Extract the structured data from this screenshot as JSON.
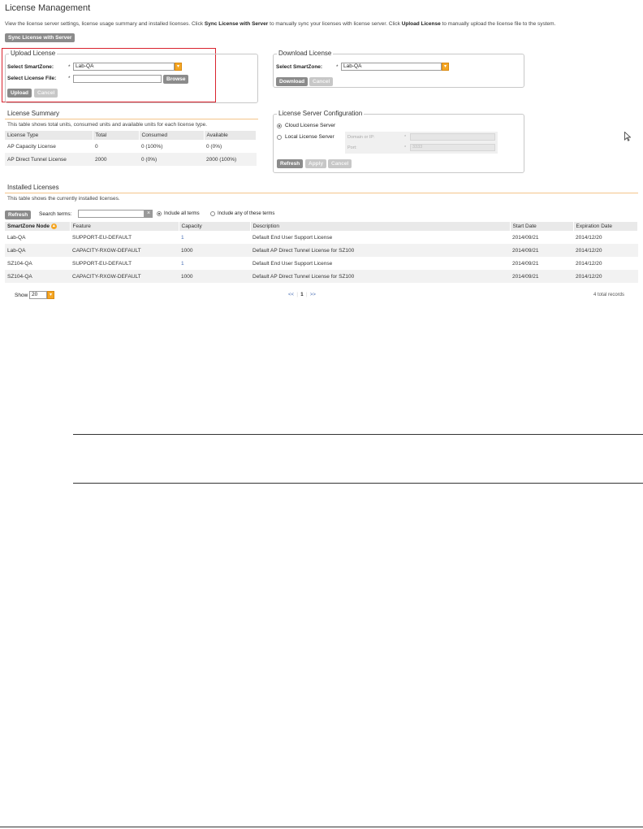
{
  "header": {
    "title": "License Management",
    "desc_1": "View the license server settings, license usage summary and installed licenses. Click ",
    "desc_sync": "Sync License with Server",
    "desc_2": " to manually sync your licenses with license server. Click ",
    "desc_upload": "Upload License",
    "desc_3": " to manually upload the license file to the system.",
    "sync_button": "Sync License with Server"
  },
  "upload": {
    "legend": "Upload License",
    "smartzone_label": "Select SmartZone:",
    "smartzone_value": "Lab-QA",
    "file_label": "Select License File:",
    "file_value": "",
    "required": "*",
    "browse_button": "Browse",
    "upload_button": "Upload",
    "cancel_button": "Cancel"
  },
  "download": {
    "legend": "Download License",
    "smartzone_label": "Select SmartZone:",
    "smartzone_value": "Lab-QA",
    "required": "*",
    "download_button": "Download",
    "cancel_button": "Cancel"
  },
  "summary": {
    "title": "License Summary",
    "desc": "This table shows total units, consumed units and available units for each license type.",
    "columns": [
      "License Type",
      "Total",
      "Consumed",
      "Available"
    ],
    "rows": [
      [
        "AP Capacity License",
        "0",
        "0 (100%)",
        "0 (0%)"
      ],
      [
        "AP Direct Tunnel License",
        "2000",
        "0 (0%)",
        "2000 (100%)"
      ]
    ]
  },
  "server_config": {
    "legend": "License Server Configuration",
    "cloud_label": "Cloud License Server",
    "local_label": "Local License Server",
    "domain_label": "Domain or IP:",
    "port_label": "Port:",
    "required": "*",
    "port_value": "3333",
    "refresh_button": "Refresh",
    "apply_button": "Apply",
    "cancel_button": "Cancel"
  },
  "installed": {
    "title": "Installed Licenses",
    "desc": "This table shows the currently installed licenses.",
    "refresh_button": "Refresh",
    "search_label": "Search terms:",
    "search_value": "",
    "clear_icon": "×",
    "include_all": "Include all terms",
    "include_any": "Include any of these terms",
    "columns": [
      "SmartZone Node",
      "Feature",
      "Capacity",
      "Description",
      "Start Date",
      "Expiration Date"
    ],
    "rows": [
      [
        "Lab-QA",
        "SUPPORT-EU-DEFAULT",
        "1",
        "Default End User Support License",
        "2014/09/21",
        "2014/12/20"
      ],
      [
        "Lab-QA",
        "CAPACITY-RXGW-DEFAULT",
        "1000",
        "Default AP Direct Tunnel License for SZ100",
        "2014/09/21",
        "2014/12/20"
      ],
      [
        "SZ104-QA",
        "SUPPORT-EU-DEFAULT",
        "1",
        "Default End User Support License",
        "2014/09/21",
        "2014/12/20"
      ],
      [
        "SZ104-QA",
        "CAPACITY-RXGW-DEFAULT",
        "1000",
        "Default AP Direct Tunnel License for SZ100",
        "2014/09/21",
        "2014/12/20"
      ]
    ],
    "show_label": "Show",
    "show_value": "20",
    "pager_first": "<<",
    "pager_page": "1",
    "pager_next": ">>",
    "total_records": "4 total records"
  },
  "colors": {
    "accent": "#f5a623",
    "highlight_border": "#d9232e",
    "button": "#8b8b8b"
  }
}
